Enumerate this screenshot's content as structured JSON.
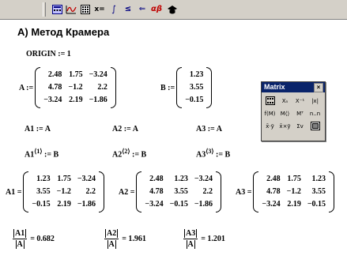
{
  "toolbar": {
    "buttons": [
      {
        "name": "calculator-toolbar-icon",
        "glyph": "▦"
      },
      {
        "name": "graph-toolbar-icon",
        "glyph": "∿"
      },
      {
        "name": "matrix-toolbar-icon",
        "glyph": "⊞"
      },
      {
        "name": "evaluation-toolbar-icon",
        "glyph": "x="
      },
      {
        "name": "calculus-toolbar-icon",
        "glyph": "∫"
      },
      {
        "name": "boolean-toolbar-icon",
        "glyph": "≤"
      },
      {
        "name": "programming-toolbar-icon",
        "glyph": "⇐"
      },
      {
        "name": "greek-toolbar-icon",
        "glyph": "αβ"
      },
      {
        "name": "symbolic-toolbar-icon",
        "glyph": "♣"
      }
    ]
  },
  "heading": "А) Метод Крамера",
  "origin": "ORIGIN := 1",
  "matrix_A": {
    "label": "A :=",
    "rows": [
      [
        "2.48",
        "1.75",
        "−3.24"
      ],
      [
        "4.78",
        "−1.2",
        "2.2"
      ],
      [
        "−3.24",
        "2.19",
        "−1.86"
      ]
    ]
  },
  "matrix_B": {
    "label": "B :=",
    "rows": [
      [
        "1.23"
      ],
      [
        "3.55"
      ],
      [
        "−0.15"
      ]
    ]
  },
  "assign": {
    "a1": "A1 := A",
    "a2": "A2 := A",
    "a3": "A3 := A"
  },
  "col_assign": {
    "a1": {
      "name": "A1",
      "sup": "⟨1⟩",
      "rest": " := B"
    },
    "a2": {
      "name": "A2",
      "sup": "⟨2⟩",
      "rest": " := B"
    },
    "a3": {
      "name": "A3",
      "sup": "⟨3⟩",
      "rest": " := B"
    }
  },
  "matrix_A1": {
    "label": "A1 =",
    "rows": [
      [
        "1.23",
        "1.75",
        "−3.24"
      ],
      [
        "3.55",
        "−1.2",
        "2.2"
      ],
      [
        "−0.15",
        "2.19",
        "−1.86"
      ]
    ]
  },
  "matrix_A2": {
    "label": "A2 =",
    "rows": [
      [
        "2.48",
        "1.23",
        "−3.24"
      ],
      [
        "4.78",
        "3.55",
        "2.2"
      ],
      [
        "−3.24",
        "−0.15",
        "−1.86"
      ]
    ]
  },
  "matrix_A3": {
    "label": "A3 =",
    "rows": [
      [
        "2.48",
        "1.75",
        "1.23"
      ],
      [
        "4.78",
        "−1.2",
        "3.55"
      ],
      [
        "−3.24",
        "2.19",
        "−0.15"
      ]
    ]
  },
  "results": [
    {
      "num": "A1",
      "den": "A",
      "value": "= 0.682"
    },
    {
      "num": "A2",
      "den": "A",
      "value": "= 1.961"
    },
    {
      "num": "A3",
      "den": "A",
      "value": "= 1.201"
    }
  ],
  "palette": {
    "title": "Matrix",
    "close": "×",
    "buttons": [
      {
        "name": "matrix-insert-icon",
        "glyph": "⊞"
      },
      {
        "name": "subscript-icon",
        "glyph": "Xₙ"
      },
      {
        "name": "inverse-icon",
        "glyph": "X⁻¹"
      },
      {
        "name": "determinant-icon",
        "glyph": "|x|"
      },
      {
        "name": "vectorize-icon",
        "glyph": "f(M)"
      },
      {
        "name": "column-icon",
        "glyph": "M⟨⟩"
      },
      {
        "name": "transpose-icon",
        "glyph": "Mᵀ"
      },
      {
        "name": "range-icon",
        "glyph": "n..n"
      },
      {
        "name": "dot-product-icon",
        "glyph": "x̄·ȳ"
      },
      {
        "name": "cross-product-icon",
        "glyph": "x̄×ȳ"
      },
      {
        "name": "vector-sum-icon",
        "glyph": "Σv"
      },
      {
        "name": "picture-icon",
        "glyph": "▣"
      }
    ]
  }
}
